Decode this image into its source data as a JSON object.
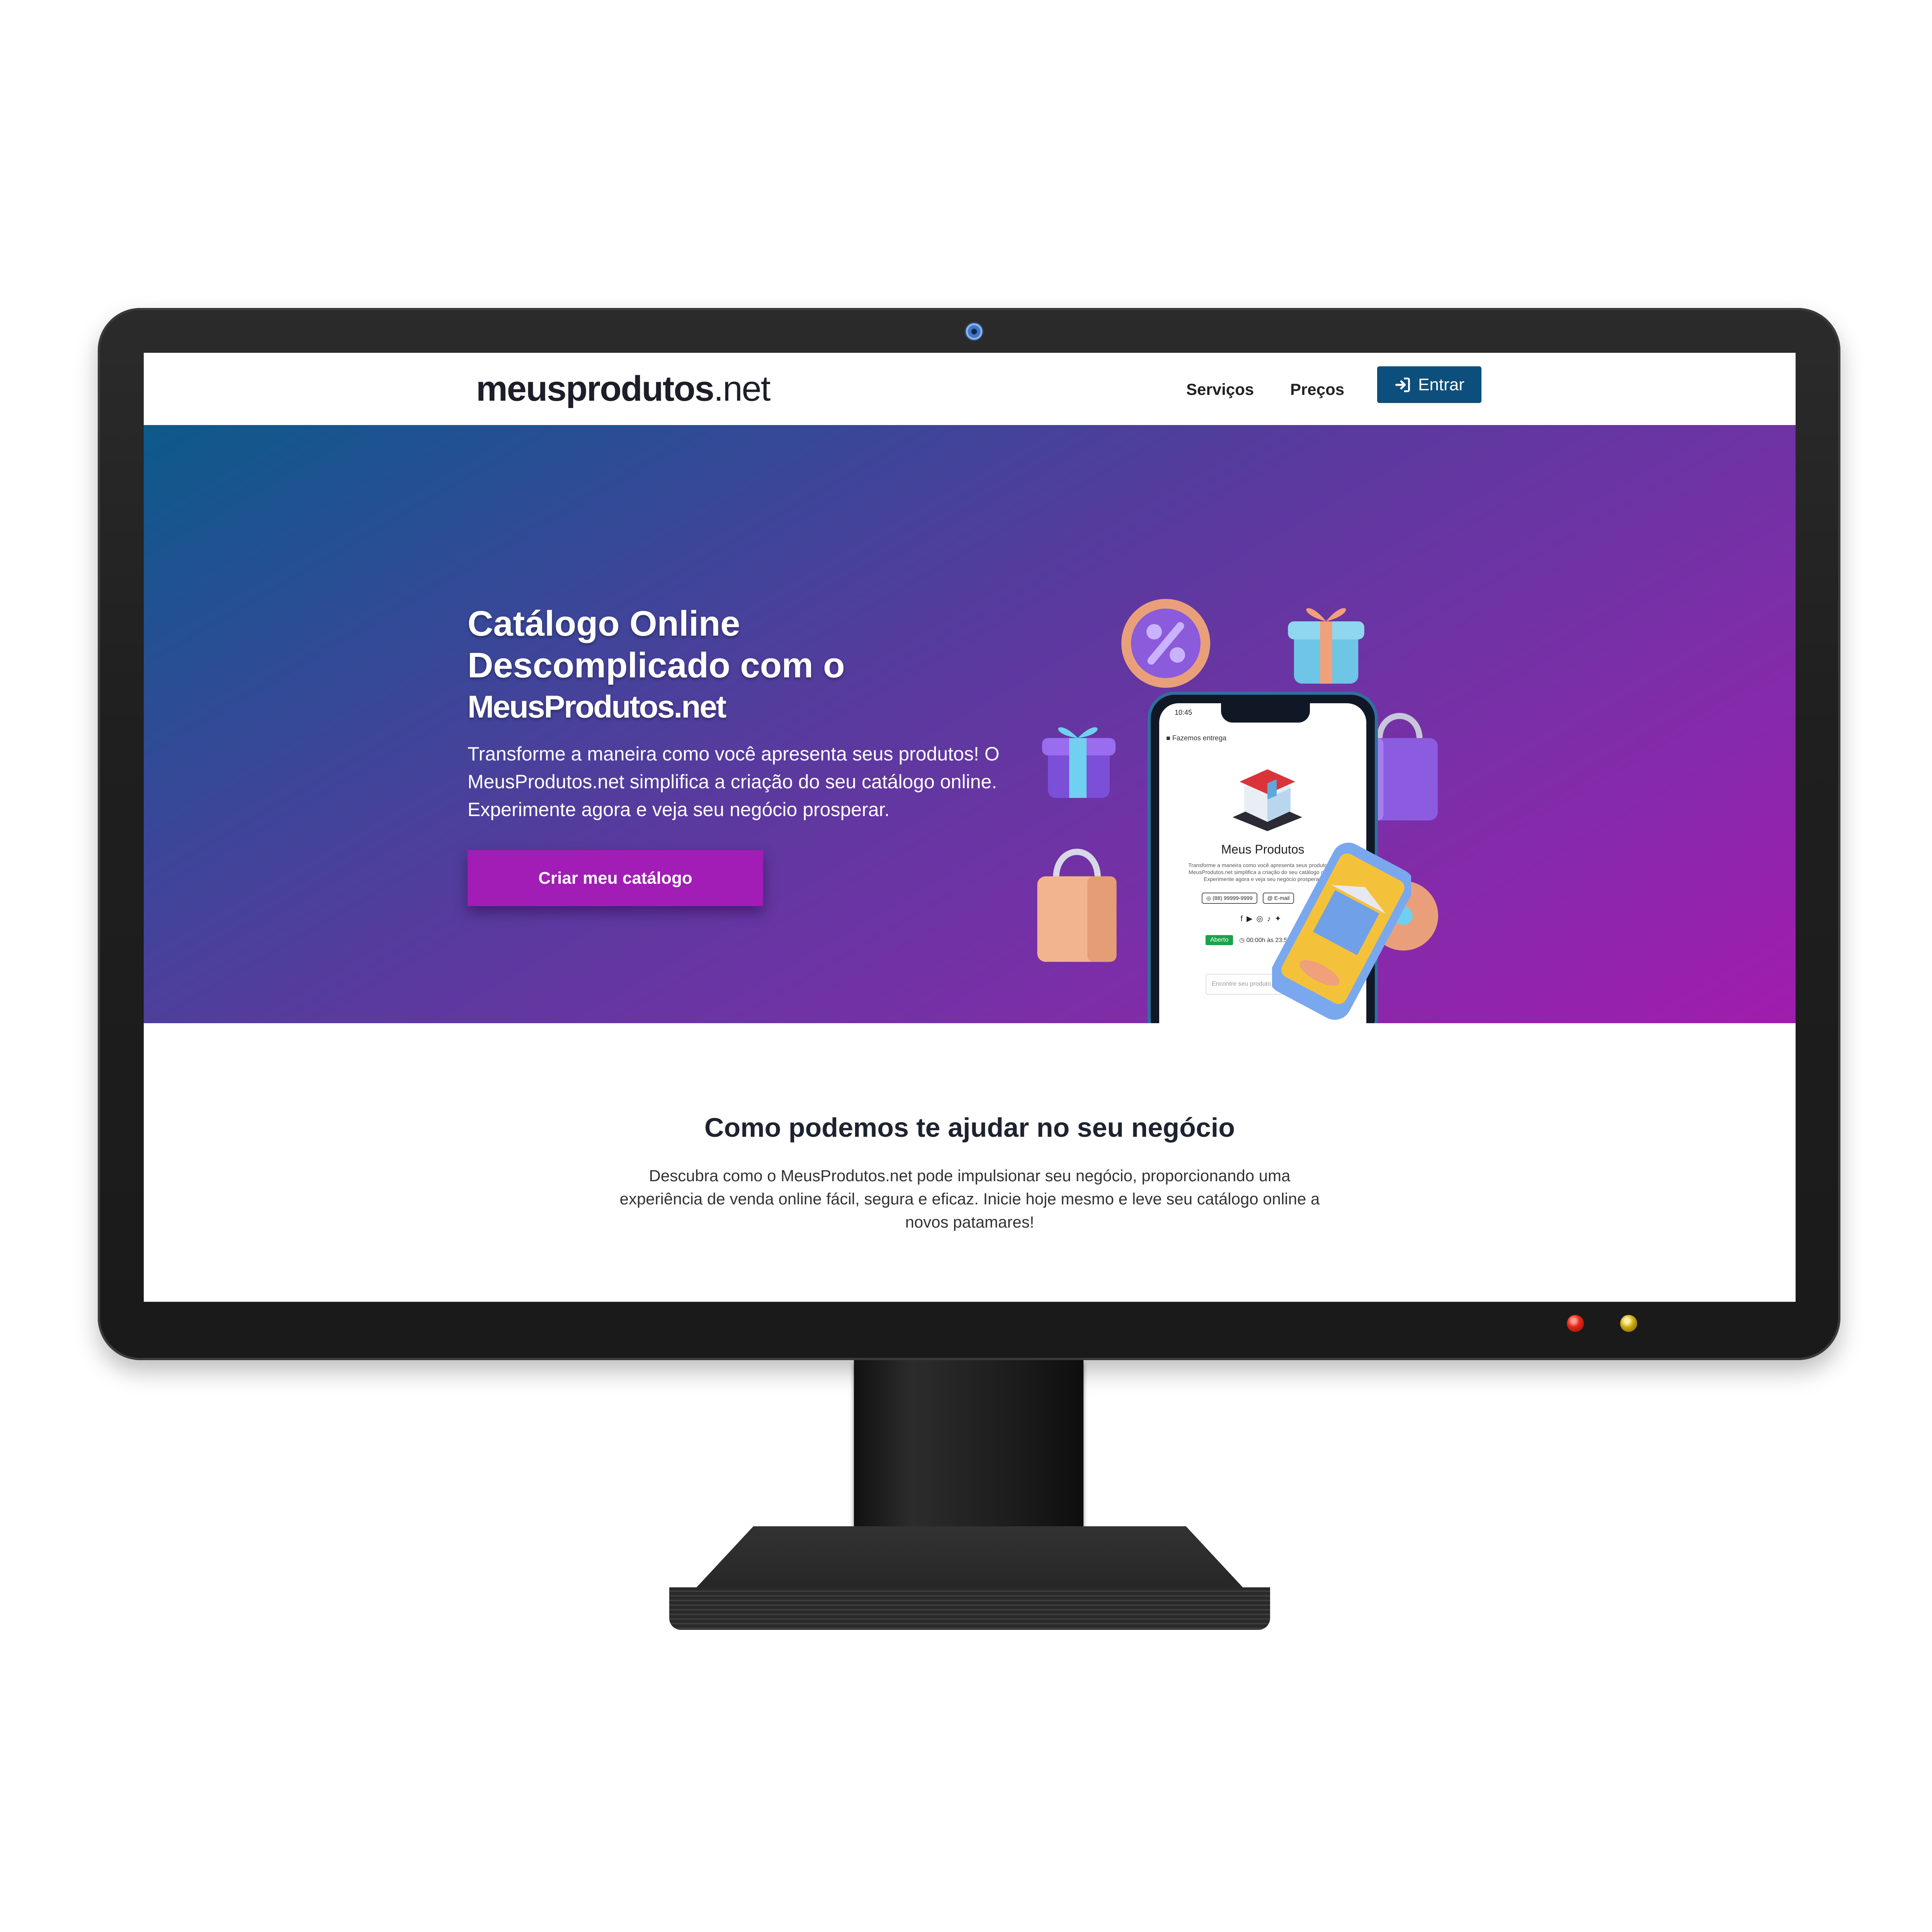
{
  "navbar": {
    "logo_bold": "meusprodutos",
    "logo_light": ".net",
    "links": [
      "Serviços",
      "Preços"
    ],
    "login_label": "Entrar"
  },
  "hero": {
    "title_line1": "Catálogo Online",
    "title_line2": "Descomplicado com o",
    "title_brand": "MeusProdutos.net",
    "subtitle": "Transforme a maneira como você apresenta seus produtos! O MeusProdutos.net simplifica a criação do seu catálogo online. Experimente agora e veja seu negócio prosperar.",
    "cta_label": "Criar meu catálogo"
  },
  "phone": {
    "time": "10:45",
    "delivery": "Fazemos entrega",
    "store_name": "Meus Produtos",
    "store_desc": "Transforme a maneira como você apresenta seus produtos! O MeusProdutos.net simplifica a criação do seu catálogo online. Experimente agora e veja seu negócio prosperar.",
    "phone_number": "(88) 99999-9999",
    "email_label": "E-mail",
    "status": "Aberto",
    "hours": "00:00h às 23:59h",
    "search_placeholder": "Encontre seu produto",
    "social_icons": [
      "facebook-icon",
      "youtube-icon",
      "instagram-icon",
      "tiktok-icon",
      "twitter-icon"
    ]
  },
  "section": {
    "title": "Como podemos te ajudar no seu negócio",
    "text": "Descubra como o MeusProdutos.net pode impulsionar seu negócio, proporcionando uma experiência de venda online fácil, segura e eficaz. Inicie hoje mesmo e leve seu catálogo online a novos patamares!"
  },
  "colors": {
    "login_button": "#0d4f7c",
    "cta_button": "#a21cb6",
    "hero_start": "#0c5a8a",
    "hero_end": "#a11cae",
    "status_open": "#1aa34a"
  }
}
